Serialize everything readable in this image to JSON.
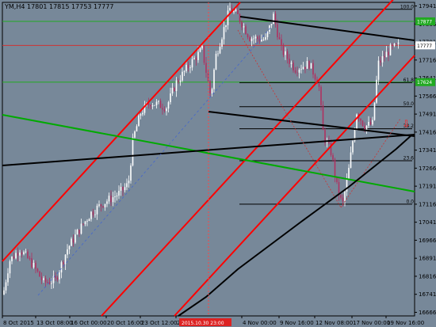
{
  "chart": {
    "symbol_line": "YM,H4  17801  17815  17753  17777",
    "background": "#778899",
    "axis_color": "#000000",
    "bull_color": "#ffffff",
    "bear_color": "#b03060",
    "ma_color": "#000000"
  },
  "price_axis": {
    "labels": [
      "17941",
      "17866",
      "17791",
      "17716",
      "17641",
      "17566",
      "17491",
      "17416",
      "17341",
      "17266",
      "17191",
      "17116",
      "17041",
      "16966",
      "16891",
      "16816",
      "16741",
      "16666"
    ],
    "badges": [
      {
        "text": "17877",
        "bg": "#22aa22",
        "color": "#ffffff",
        "price": 17877
      },
      {
        "text": "17777",
        "bg": "#ffffff",
        "color": "#000000",
        "price": 17777
      },
      {
        "text": "17624",
        "bg": "#22aa22",
        "color": "#ffffff",
        "price": 17624
      }
    ]
  },
  "time_axis": {
    "labels": [
      "8 Oct 2015",
      "13 Oct 08:00",
      "16 Oct 00:00",
      "20 Oct 16:00",
      "23 Oct 12:00",
      "28",
      "4 Nov 00:00",
      "9 Nov 16:00",
      "12 Nov 08:00",
      "17 Nov 00:00",
      "19 Nov 16:00"
    ],
    "cursor_label": "2015.10.30 23:00"
  },
  "fib_levels": [
    {
      "label": "100.0",
      "price": 17927
    },
    {
      "label": "61.8",
      "price": 17622
    },
    {
      "label": "50.0",
      "price": 17522
    },
    {
      "label": "38.2",
      "price": 17430
    },
    {
      "label": "23.6",
      "price": 17297
    },
    {
      "label": "0.0",
      "price": 17116
    }
  ],
  "horizontal_lines": {
    "green_levels": [
      17877,
      17624
    ],
    "red_level": 17777,
    "green_color": "#22aa22",
    "red_color": "#cc3333"
  },
  "trend_lines": {
    "red_channel_color": "#ff0000",
    "green_color": "#00aa00",
    "black_color": "#000000",
    "blue_dashed_color": "#4466cc",
    "red_dotted_color": "#cc3333"
  },
  "alert_arrow": {
    "symbol": "⇩",
    "color": "#ff2222"
  }
}
